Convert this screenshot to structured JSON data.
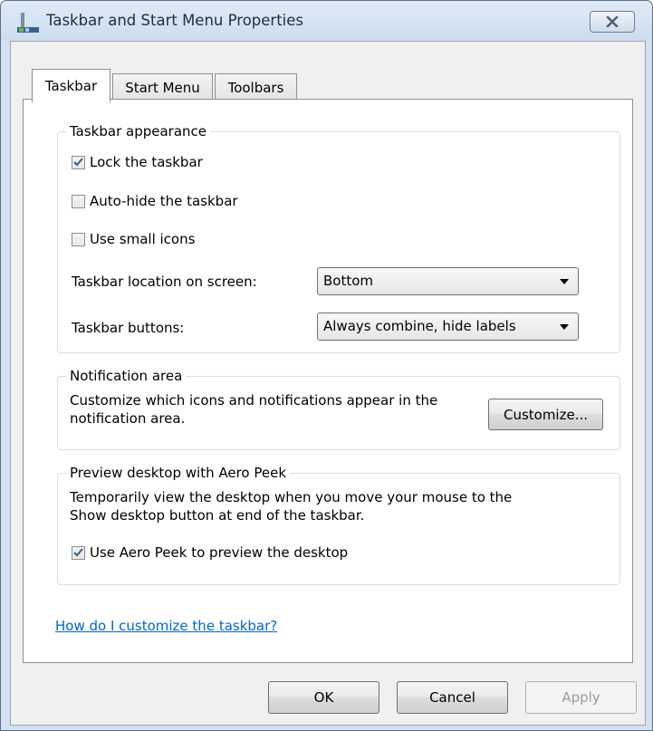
{
  "window": {
    "title": "Taskbar and Start Menu Properties"
  },
  "tabs": [
    {
      "label": "Taskbar",
      "active": true
    },
    {
      "label": "Start Menu",
      "active": false
    },
    {
      "label": "Toolbars",
      "active": false
    }
  ],
  "taskbar_appearance": {
    "title": "Taskbar appearance",
    "lock_taskbar": {
      "label": "Lock the taskbar",
      "checked": true
    },
    "auto_hide": {
      "label": "Auto-hide the taskbar",
      "checked": false
    },
    "small_icons": {
      "label": "Use small icons",
      "checked": false
    },
    "location_label": "Taskbar location on screen:",
    "location_value": "Bottom",
    "buttons_label": "Taskbar buttons:",
    "buttons_value": "Always combine, hide labels"
  },
  "notification_area": {
    "title": "Notification area",
    "description_line1": "Customize which icons and notifications appear in the",
    "description_line2": "notification area.",
    "customize_label": "Customize..."
  },
  "aero_peek": {
    "title": "Preview desktop with Aero Peek",
    "description_line1": "Temporarily view the desktop when you move your mouse to the",
    "description_line2": "Show desktop button at end of the taskbar.",
    "use_aero_peek": {
      "label": "Use Aero Peek to preview the desktop",
      "checked": true
    }
  },
  "help_link": "How do I customize the taskbar?",
  "footer": {
    "ok": "OK",
    "cancel": "Cancel",
    "apply": "Apply"
  },
  "icons": {
    "window_icon": "taskbar-properties-icon",
    "close": "close-icon",
    "checkmark": "checkmark-icon",
    "dropdown": "chevron-down-icon"
  },
  "colors": {
    "link": "#0066cc",
    "check": "#2c5d9c",
    "frame": "#d3e1f1"
  }
}
